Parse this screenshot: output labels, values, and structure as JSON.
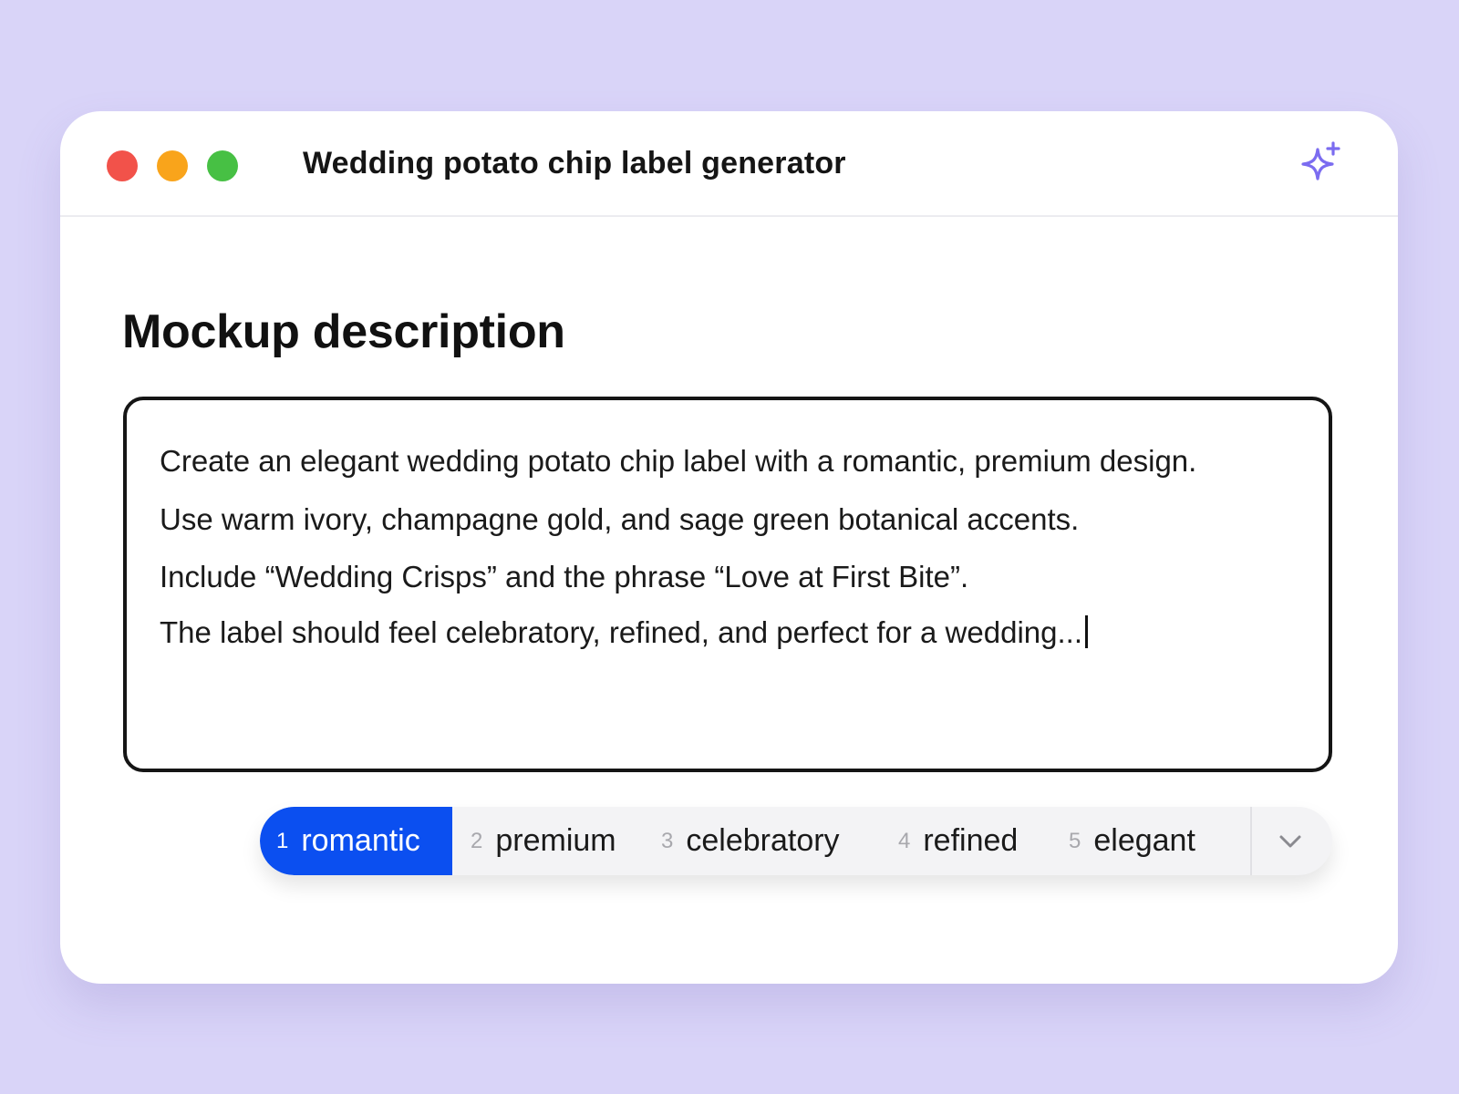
{
  "window": {
    "title": "Wedding potato chip label generator",
    "controls": [
      {
        "name": "close",
        "color": "#f2524a"
      },
      {
        "name": "minimize",
        "color": "#f9a41b"
      },
      {
        "name": "maximize",
        "color": "#47c044"
      }
    ],
    "action_icon": "sparkle-icon",
    "accent_color": "#7b6cf0"
  },
  "main": {
    "heading": "Mockup description",
    "description_lines": [
      "Create an elegant wedding potato chip label with a romantic, premium design.",
      "Use warm ivory, champagne gold, and sage green botanical accents.",
      "Include “Wedding Crisps” and the phrase “Love at First Bite”.",
      "The label should feel celebratory, refined, and perfect for a wedding..."
    ]
  },
  "suggestions": {
    "selected_color": "#0b4ff0",
    "items": [
      {
        "num": "1",
        "word": "romantic",
        "selected": true
      },
      {
        "num": "2",
        "word": "premium",
        "selected": false
      },
      {
        "num": "3",
        "word": "celebratory",
        "selected": false
      },
      {
        "num": "4",
        "word": "refined",
        "selected": false
      },
      {
        "num": "5",
        "word": "elegant",
        "selected": false
      }
    ],
    "expand_icon": "chevron-down-icon"
  }
}
